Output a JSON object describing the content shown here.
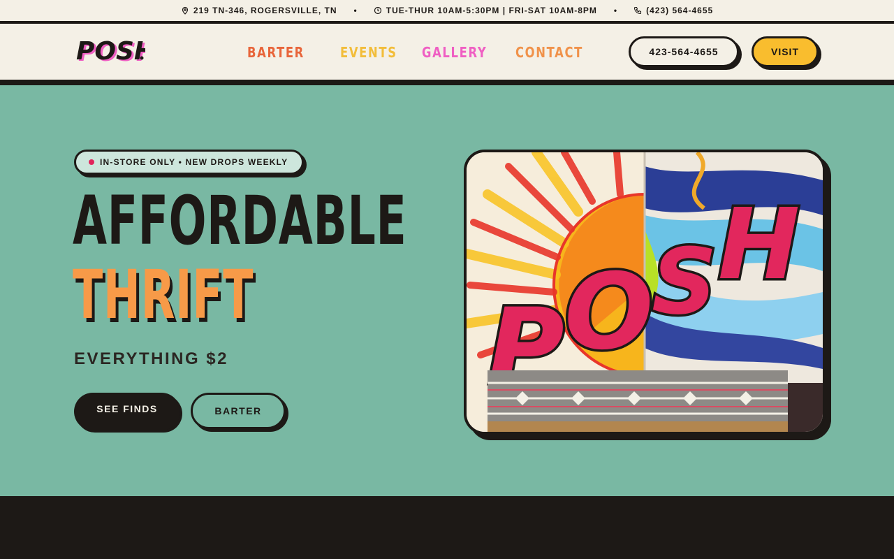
{
  "topbar": {
    "address": "219 TN-346, ROGERSVILLE, TN",
    "hours": "TUE-THUR 10AM-5:30PM | FRI-SAT 10AM-8PM",
    "phone": "(423) 564-4655",
    "separator": "•",
    "icons": [
      "location-pin-icon",
      "clock-icon",
      "phone-icon"
    ]
  },
  "header": {
    "logo_text": "POSH",
    "nav": {
      "barter": "BARTER",
      "events": "EVENTS",
      "gallery": "GALLERY",
      "contact": "CONTACT"
    },
    "phone_button": "423-564-4655",
    "visit_button": "VISIT"
  },
  "hero": {
    "pill_text": "IN-STORE ONLY • NEW DROPS WEEKLY",
    "headline_1": "AFFORDABLE",
    "headline_2": "THRIFT",
    "subheading": "EVERYTHING $2",
    "primary_button": "SEE FINDS",
    "secondary_button": "BARTER",
    "photo_text": "POSH"
  },
  "colors": {
    "ink": "#1d1916",
    "cream": "#f4f0e6",
    "teal": "#79b8a3",
    "orange": "#f79a48",
    "yellow": "#f9bd2e",
    "pink": "#ef5fc3",
    "red_orange": "#e8653a"
  }
}
